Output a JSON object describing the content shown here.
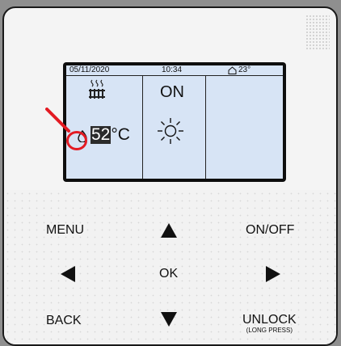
{
  "status_bar": {
    "date": "05/11/2020",
    "time": "10:34",
    "indoor_temp": "23°",
    "home_icon": "home-icon"
  },
  "left_panel": {
    "heater_icon": "radiator-heating-icon",
    "drop_icon": "water-drop-icon",
    "setpoint_value": "52",
    "setpoint_unit": "°C"
  },
  "middle_panel": {
    "state": "ON",
    "mode_icon": "sun-icon"
  },
  "annotation": {
    "color": "#e31b23"
  },
  "keys": {
    "menu": "MENU",
    "on_off": "ON/OFF",
    "ok": "OK",
    "back": "BACK",
    "unlock": "UNLOCK",
    "unlock_hint": "(LONG PRESS)",
    "up_icon": "up-arrow-icon",
    "down_icon": "down-arrow-icon",
    "left_icon": "left-arrow-icon",
    "right_icon": "right-arrow-icon"
  },
  "colors": {
    "screen_bg": "#d7e4f5",
    "bezel": "#0e0e0e",
    "device_body": "#f4f4f4"
  }
}
